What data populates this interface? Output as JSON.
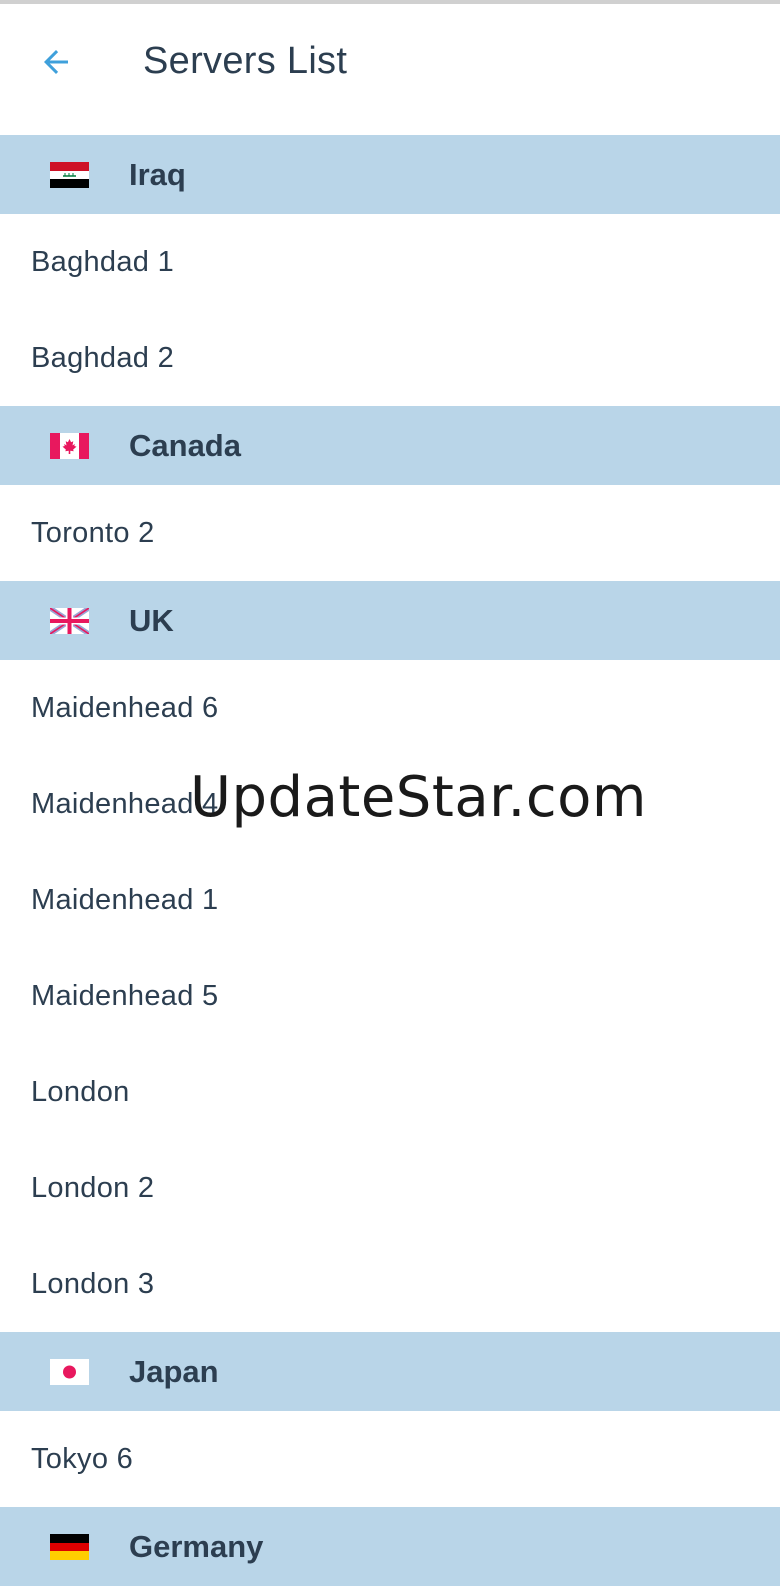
{
  "app_bar": {
    "title": "Servers List",
    "back_icon": "arrow-back-icon",
    "accent_color": "#3fa0db"
  },
  "groups": [
    {
      "country": "Iraq",
      "flag_icon": "flag-iraq-icon",
      "servers": [
        "Baghdad 1",
        "Baghdad 2"
      ]
    },
    {
      "country": "Canada",
      "flag_icon": "flag-canada-icon",
      "servers": [
        "Toronto 2"
      ]
    },
    {
      "country": "UK",
      "flag_icon": "flag-uk-icon",
      "servers": [
        "Maidenhead 6",
        "Maidenhead 4",
        "Maidenhead 1",
        "Maidenhead 5",
        "London",
        "London 2",
        "London 3"
      ]
    },
    {
      "country": "Japan",
      "flag_icon": "flag-japan-icon",
      "servers": [
        "Tokyo 6"
      ]
    },
    {
      "country": "Germany",
      "flag_icon": "flag-germany-icon",
      "servers": []
    }
  ],
  "colors": {
    "header_bg": "#b9d5e8",
    "text": "#2c3e50"
  },
  "watermark": "UpdateStar.com"
}
